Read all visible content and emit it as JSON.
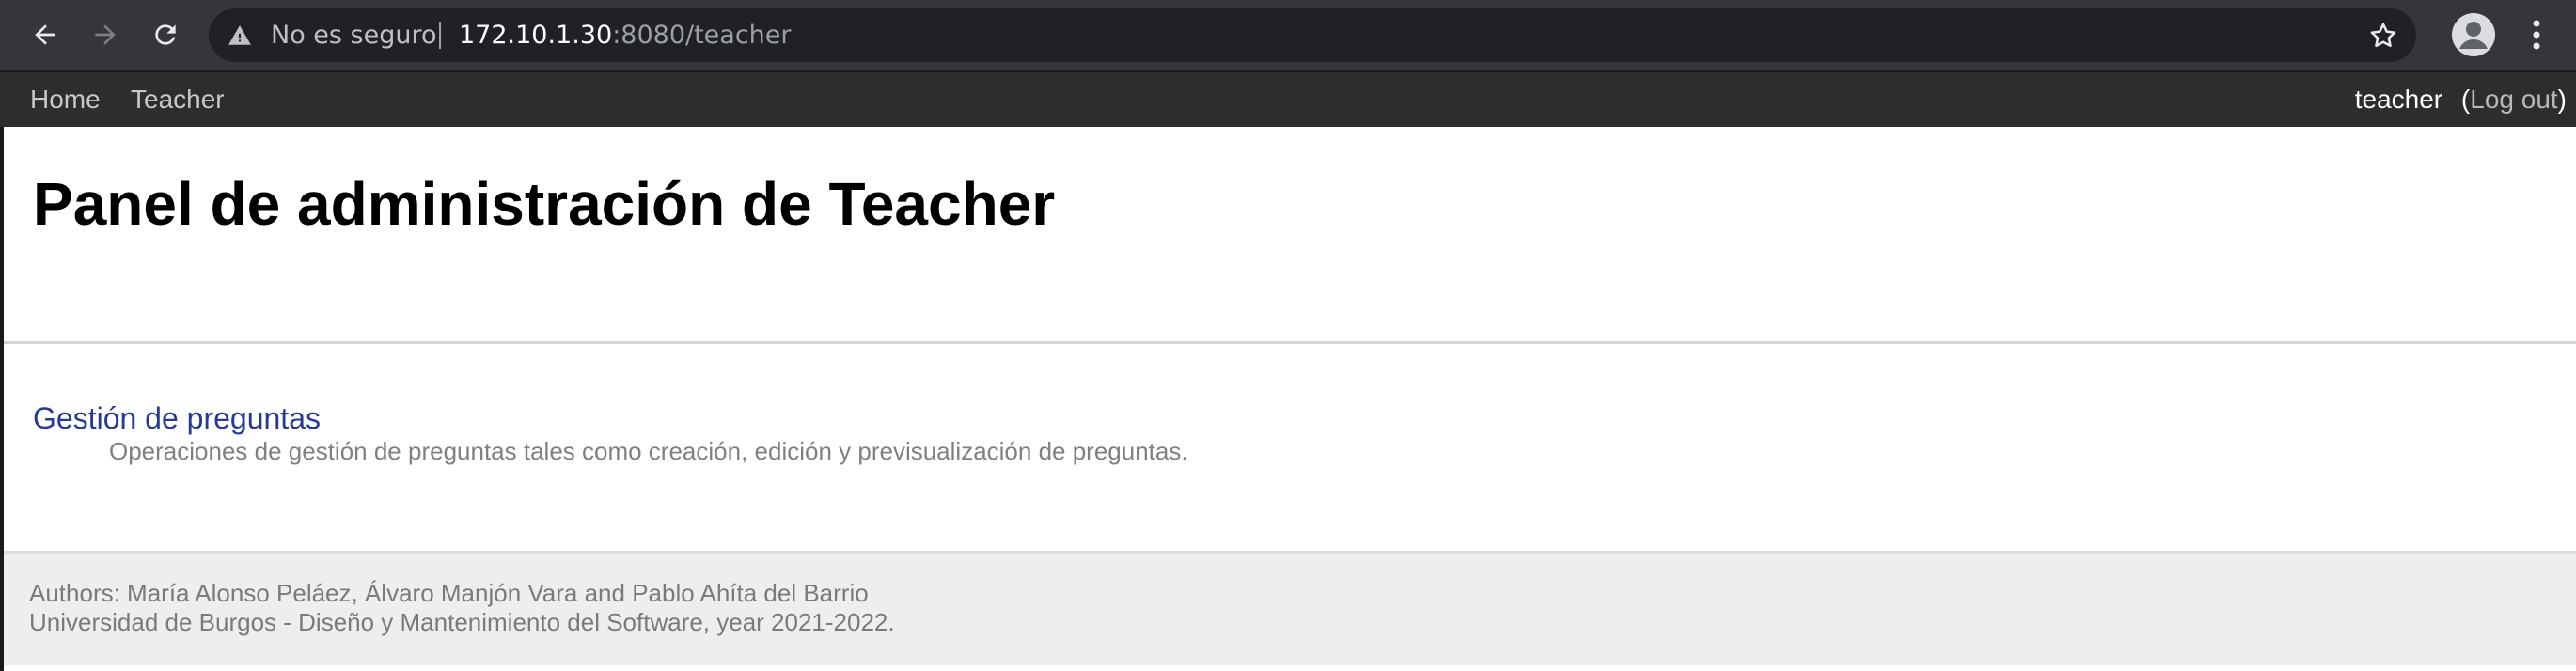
{
  "browser": {
    "security_label": "No es seguro",
    "url_host": "172.10.1.30",
    "url_rest": ":8080/teacher",
    "icons": {
      "back": "back-arrow-icon",
      "forward": "forward-arrow-icon",
      "reload": "reload-icon",
      "warning": "warning-triangle-icon",
      "bookmark": "star-icon",
      "profile": "profile-avatar-icon",
      "menu": "kebab-menu-icon"
    }
  },
  "nav": {
    "home": "Home",
    "teacher": "Teacher",
    "username": "teacher",
    "logout_open": "(",
    "logout": "Log out",
    "logout_close": ")"
  },
  "page": {
    "title": "Panel de administración de Teacher"
  },
  "modules": [
    {
      "title": "Gestión de preguntas",
      "description": "Operaciones de gestión de preguntas tales como creación, edición y previsualización de preguntas."
    }
  ],
  "footer": {
    "authors": "Authors: María Alonso Peláez, Álvaro Manjón Vara and Pablo Ahíta del Barrio",
    "university": "Universidad de Burgos - Diseño y Mantenimiento del Software, year 2021-2022."
  },
  "colors": {
    "chrome_bg": "#35363a",
    "omnibox_bg": "#202124",
    "nav_bg": "#2d2d2d",
    "link": "#243a95",
    "footer_bg": "#eeeeee"
  }
}
